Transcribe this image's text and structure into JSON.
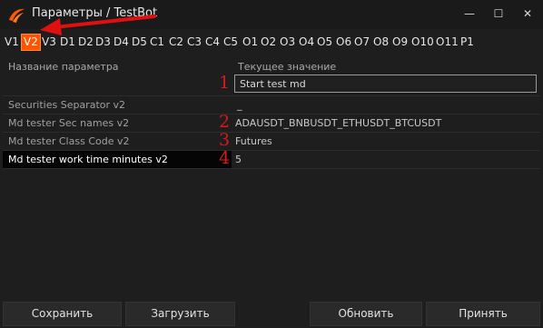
{
  "window": {
    "title": "Параметры / TestBot",
    "min_glyph": "—",
    "max_glyph": "☐",
    "close_glyph": "✕"
  },
  "tabs": [
    "V1",
    "V2",
    "V3",
    "D1",
    "D2",
    "D3",
    "D4",
    "D5",
    "C1",
    "C2",
    "C3",
    "C4",
    "C5",
    "O1",
    "O2",
    "O3",
    "O4",
    "O5",
    "O6",
    "O7",
    "O8",
    "O9",
    "O10",
    "O11",
    "P1"
  ],
  "active_tab": "V2",
  "grid": {
    "header_name": "Название параметра",
    "header_value": "Текущее значение",
    "edit_value": "Start test md",
    "rows": [
      {
        "name": "Securities Separator v2",
        "value": "_",
        "marker": ""
      },
      {
        "name": "Md tester Sec names v2",
        "value": "ADAUSDT_BNBUSDT_ETHUSDT_BTCUSDT",
        "marker": "2"
      },
      {
        "name": "Md tester Class Code v2",
        "value": "Futures",
        "marker": "3"
      },
      {
        "name": "Md tester work time minutes v2",
        "value": "5",
        "marker": "4"
      }
    ],
    "edit_marker": "1"
  },
  "buttons": {
    "save": "Сохранить",
    "load": "Загрузить",
    "refresh": "Обновить",
    "accept": "Принять"
  },
  "colors": {
    "accent": "#ff5500",
    "marker": "#d81a1a",
    "background": "#1e1e1e"
  }
}
